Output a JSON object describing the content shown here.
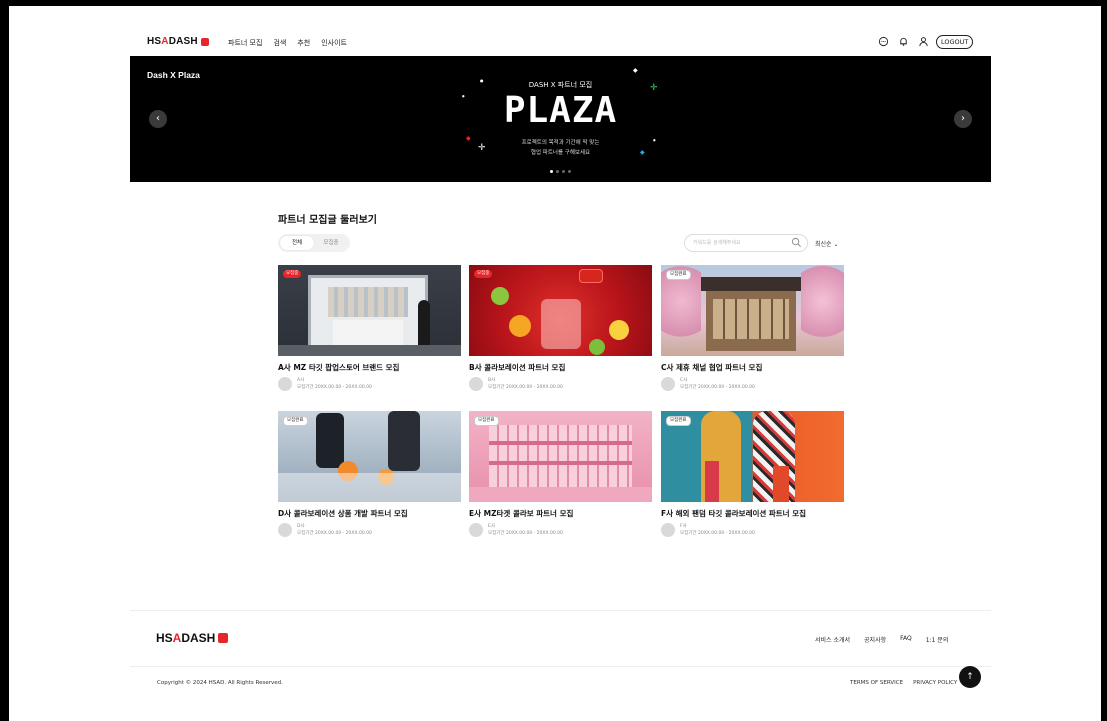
{
  "header": {
    "logo_text_a": "HS",
    "logo_text_b": "A",
    "logo_text_c": "DASH",
    "nav": [
      "파트너 모집",
      "검색",
      "추천",
      "인사이트"
    ],
    "logout": "LOGOUT"
  },
  "banner": {
    "label": "Dash X Plaza",
    "subtitle": "DASH X 파트너 모집",
    "title": "PLAZA",
    "desc_line1": "프로젝트의 목적과 기간에 딱 맞는",
    "desc_line2": "협업 파트너를 구해보세요",
    "prev": "‹",
    "next": "›"
  },
  "section": {
    "title": "파트너 모집글 둘러보기",
    "tabs": [
      "전체",
      "모집중"
    ],
    "search_placeholder": "키워드를 검색해주세요",
    "sort": "최신순"
  },
  "cards": [
    {
      "tag": "모집중",
      "title": "A사 MZ 타깃 팝업스토어 브랜드 모집",
      "company": "A사",
      "period": "모집기간 20XX.00.00 - 20XX.00.00"
    },
    {
      "tag": "모집중",
      "title": "B사 콜라보레이션 파트너 모집",
      "company": "B사",
      "period": "모집기간 20XX.00.00 - 20XX.00.00"
    },
    {
      "tag": "모집완료",
      "title": "C사 제휴 채널 협업 파트너 모집",
      "company": "C사",
      "period": "모집기간 20XX.00.00 - 20XX.00.00"
    },
    {
      "tag": "모집완료",
      "title": "D사 콜라보레이션 상품 개발 파트너 모집",
      "company": "D사",
      "period": "모집기간 20XX.00.00 - 20XX.00.00"
    },
    {
      "tag": "모집완료",
      "title": "E사 MZ타겟 콜라보 파트너 모집",
      "company": "E사",
      "period": "모집기간 20XX.00.00 - 20XX.00.00"
    },
    {
      "tag": "모집완료",
      "title": "F사 해외 팬덤 타깃 콜라보레이션 파트너 모집",
      "company": "F사",
      "period": "모집기간 20XX.00.00 - 20XX.00.00"
    }
  ],
  "footer": {
    "links": [
      "서비스 소개서",
      "공지사항",
      "FAQ",
      "1:1 문의"
    ],
    "copyright": "Copyright © 2024 HSAD. All Rights Reserved.",
    "terms": [
      "TERMS OF SERVICE",
      "PRIVACY POLICY"
    ],
    "to_top": "↑"
  }
}
